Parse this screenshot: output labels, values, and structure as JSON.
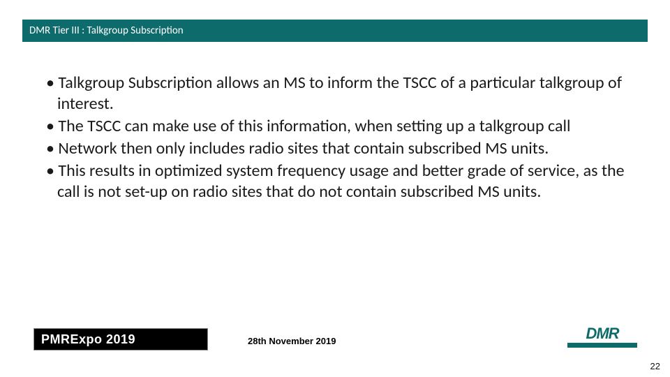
{
  "title": "DMR Tier III : Talkgroup Subscription",
  "bullets": [
    "Talkgroup Subscription allows an MS to inform the TSCC of a particular talkgroup of interest.",
    "The TSCC can make use of this information, when setting up a talkgroup call",
    "Network then only includes radio sites that contain subscribed MS units.",
    "This results in optimized system frequency usage and better grade of service, as the call is not set-up on radio sites that do not contain subscribed MS units."
  ],
  "footer": {
    "left_logo_text": "PMRExpo 2019",
    "date": "28th November 2019",
    "right_logo_text": "DMR",
    "page_number": "22"
  }
}
